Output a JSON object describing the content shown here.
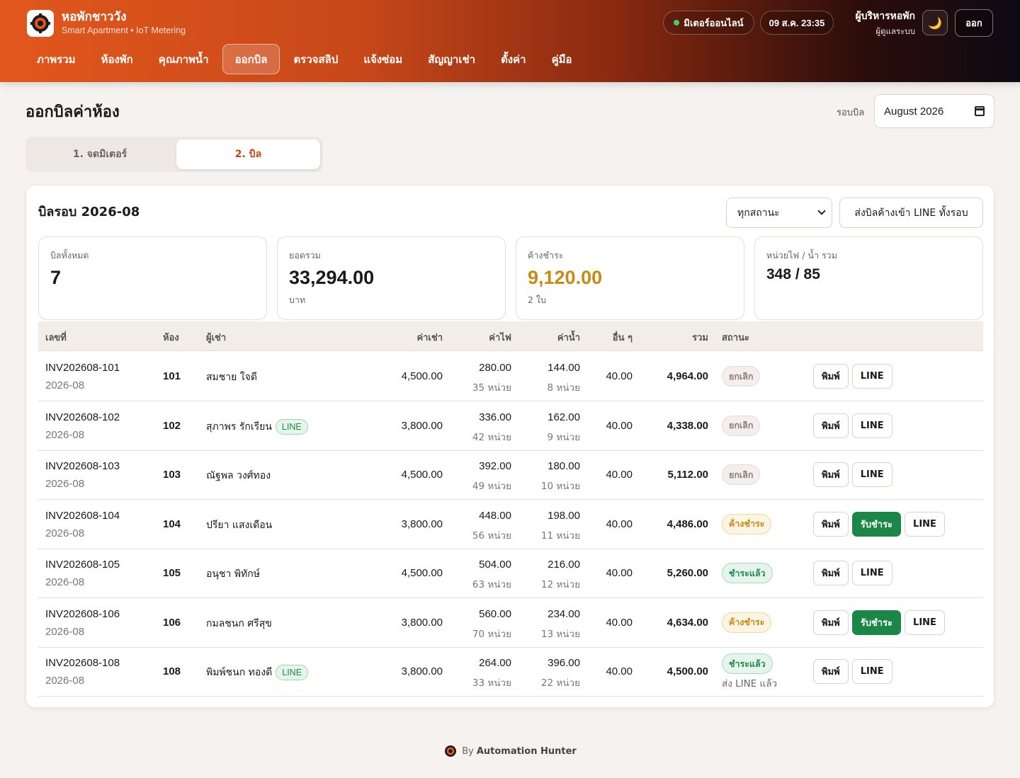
{
  "header": {
    "app_title": "หอพักชาววัง",
    "app_subtitle": "Smart Apartment • IoT Metering",
    "meter_status": "มิเตอร์ออนไลน์",
    "datetime": "09 ส.ค. 23:35",
    "user_name": "ผู้บริหารหอพัก",
    "user_role": "ผู้ดูแลระบบ",
    "theme_icon": "moon-icon",
    "logout_label": "ออก",
    "accent_color": "#e2571c"
  },
  "nav": [
    "ภาพรวม",
    "ห้องพัก",
    "คุณภาพน้ำ",
    "ออกบิล",
    "ตรวจสลิป",
    "แจ้งซ่อม",
    "สัญญาเช่า",
    "ตั้งค่า",
    "คู่มือ"
  ],
  "nav_active": "ออกบิล",
  "page": {
    "title": "ออกบิลค่าห้อง",
    "cycle_label": "รอบบิล",
    "cycle_value": "August 2026"
  },
  "tabs": {
    "step1": "1. จดมิเตอร์",
    "step2": "2. บิล",
    "active": "2. บิล"
  },
  "card": {
    "title": "บิลรอบ 2026-08",
    "status_filter": "ทุกสถานะ",
    "send_all_label": "ส่งบิลค้างเข้า LINE ทั้งรอบ"
  },
  "stats": {
    "total_bills": {
      "label": "บิลทั้งหมด",
      "value": "7"
    },
    "sum": {
      "label": "ยอดรวม",
      "value": "33,294.00",
      "sub": "บาท"
    },
    "outstanding": {
      "label": "ค้างชำระ",
      "value": "9,120.00",
      "sub": "2 ใบ",
      "color": "#c98a12"
    },
    "units": {
      "label": "หน่วยไฟ / น้ำ รวม",
      "value": "348 / 85"
    }
  },
  "table": {
    "headers": {
      "invoice": "เลขที่",
      "room": "ห้อง",
      "tenant": "ผู้เช่า",
      "rent": "ค่าเช่า",
      "electric": "ค่าไฟ",
      "water": "ค่าน้ำ",
      "other": "อื่น ๆ",
      "total": "รวม",
      "status": "สถานะ"
    },
    "print_label": "พิมพ์",
    "line_label": "LINE",
    "pay_label": "รับชำระ",
    "rows": [
      {
        "invoice": "INV202608-101",
        "period": "2026-08",
        "room": "101",
        "tenant": "สมชาย ใจดี",
        "line_tag": "",
        "rent": "4,500.00",
        "elec": "280.00",
        "elec_units": "35 หน่วย",
        "water": "144.00",
        "water_units": "8 หน่วย",
        "other": "40.00",
        "total": "4,964.00",
        "status": "ยกเลิก",
        "status_kind": "cancel",
        "note": ""
      },
      {
        "invoice": "INV202608-102",
        "period": "2026-08",
        "room": "102",
        "tenant": "สุภาพร รักเรียน",
        "line_tag": "LINE",
        "rent": "3,800.00",
        "elec": "336.00",
        "elec_units": "42 หน่วย",
        "water": "162.00",
        "water_units": "9 หน่วย",
        "other": "40.00",
        "total": "4,338.00",
        "status": "ยกเลิก",
        "status_kind": "cancel",
        "note": ""
      },
      {
        "invoice": "INV202608-103",
        "period": "2026-08",
        "room": "103",
        "tenant": "ณัฐพล วงศ์ทอง",
        "line_tag": "",
        "rent": "4,500.00",
        "elec": "392.00",
        "elec_units": "49 หน่วย",
        "water": "180.00",
        "water_units": "10 หน่วย",
        "other": "40.00",
        "total": "5,112.00",
        "status": "ยกเลิก",
        "status_kind": "cancel",
        "note": ""
      },
      {
        "invoice": "INV202608-104",
        "period": "2026-08",
        "room": "104",
        "tenant": "ปรียา แสงเดือน",
        "line_tag": "",
        "rent": "3,800.00",
        "elec": "448.00",
        "elec_units": "56 หน่วย",
        "water": "198.00",
        "water_units": "11 หน่วย",
        "other": "40.00",
        "total": "4,486.00",
        "status": "ค้างชำระ",
        "status_kind": "unpaid",
        "note": ""
      },
      {
        "invoice": "INV202608-105",
        "period": "2026-08",
        "room": "105",
        "tenant": "อนุชา พิทักษ์",
        "line_tag": "",
        "rent": "4,500.00",
        "elec": "504.00",
        "elec_units": "63 หน่วย",
        "water": "216.00",
        "water_units": "12 หน่วย",
        "other": "40.00",
        "total": "5,260.00",
        "status": "ชำระแล้ว",
        "status_kind": "paid",
        "note": ""
      },
      {
        "invoice": "INV202608-106",
        "period": "2026-08",
        "room": "106",
        "tenant": "กมลชนก ศรีสุข",
        "line_tag": "",
        "rent": "3,800.00",
        "elec": "560.00",
        "elec_units": "70 หน่วย",
        "water": "234.00",
        "water_units": "13 หน่วย",
        "other": "40.00",
        "total": "4,634.00",
        "status": "ค้างชำระ",
        "status_kind": "unpaid",
        "note": ""
      },
      {
        "invoice": "INV202608-108",
        "period": "2026-08",
        "room": "108",
        "tenant": "พิมพ์ชนก ทองดี",
        "line_tag": "LINE",
        "rent": "3,800.00",
        "elec": "264.00",
        "elec_units": "33 หน่วย",
        "water": "396.00",
        "water_units": "22 หน่วย",
        "other": "40.00",
        "total": "4,500.00",
        "status": "ชำระแล้ว",
        "status_kind": "paid",
        "note": "ส่ง LINE แล้ว"
      }
    ]
  },
  "footer": {
    "prefix": "By",
    "brand": "Automation Hunter"
  }
}
